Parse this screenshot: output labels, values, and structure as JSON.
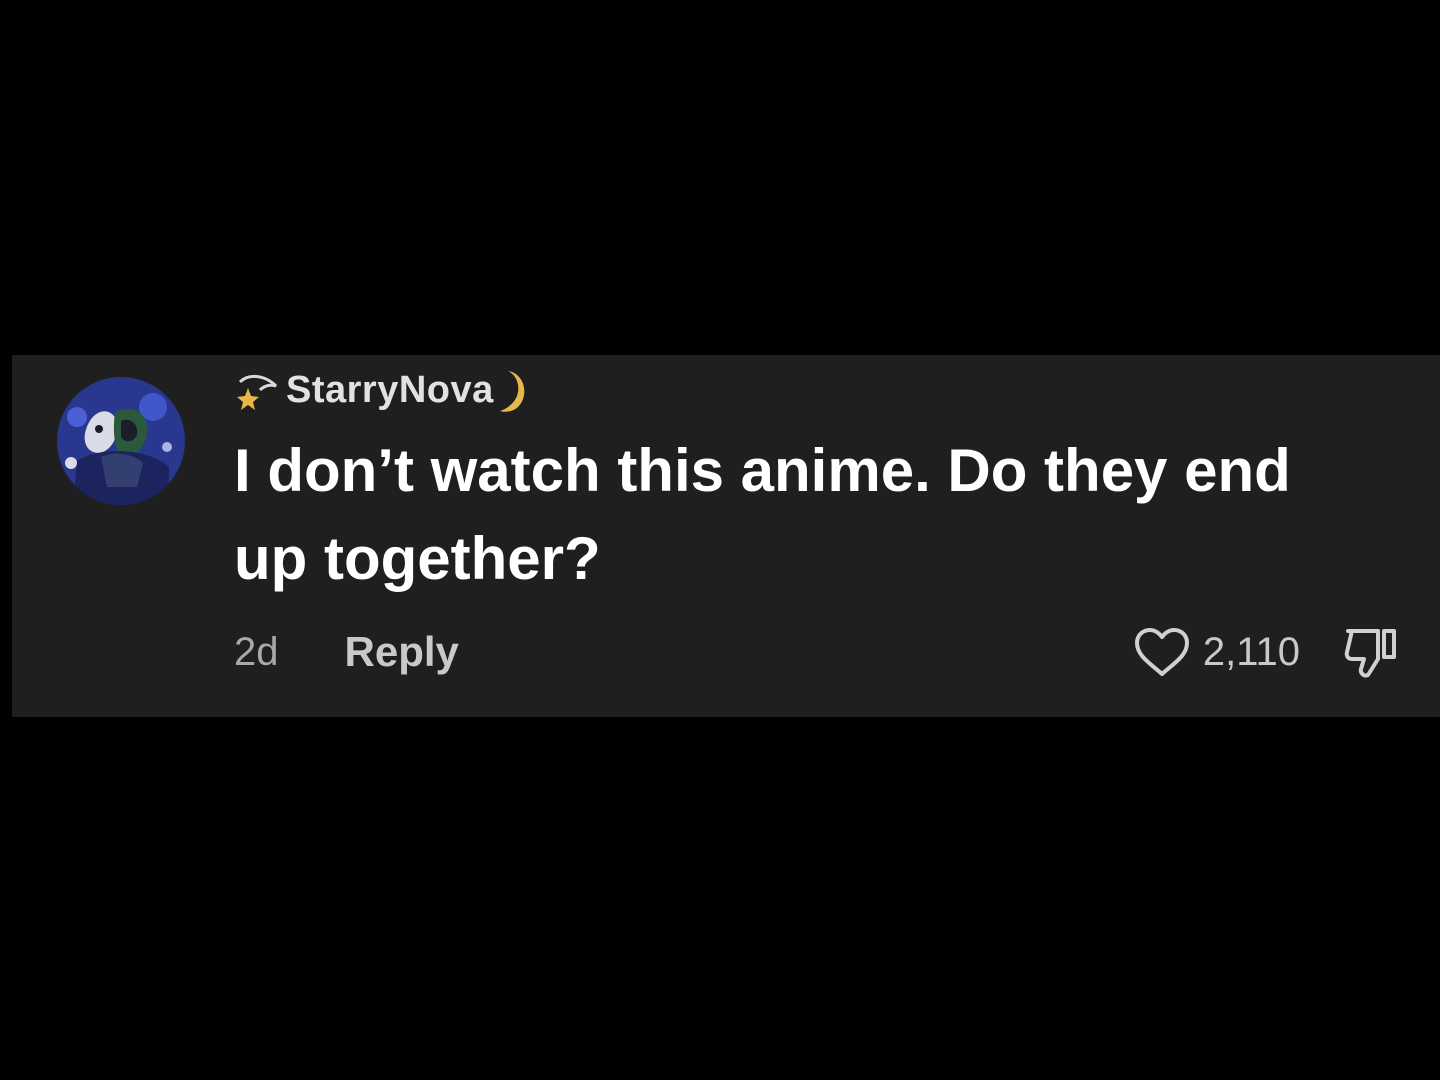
{
  "comment": {
    "username": "StarryNova",
    "text": "I don’t watch this anime. Do they end up together?",
    "timestamp": "2d",
    "reply_label": "Reply",
    "like_count": "2,110"
  },
  "icons": {
    "avatar": "avatar-image",
    "username_prefix": "shooting-star-icon",
    "username_suffix": "crescent-moon-icon",
    "like": "heart-icon",
    "dislike": "thumbs-down-icon"
  },
  "colors": {
    "page_background": "#000000",
    "card_background": "#1f1f1f",
    "comment_text": "#ffffff",
    "secondary_text": "#a9a9a9",
    "moon_accent": "#e6b84a"
  }
}
